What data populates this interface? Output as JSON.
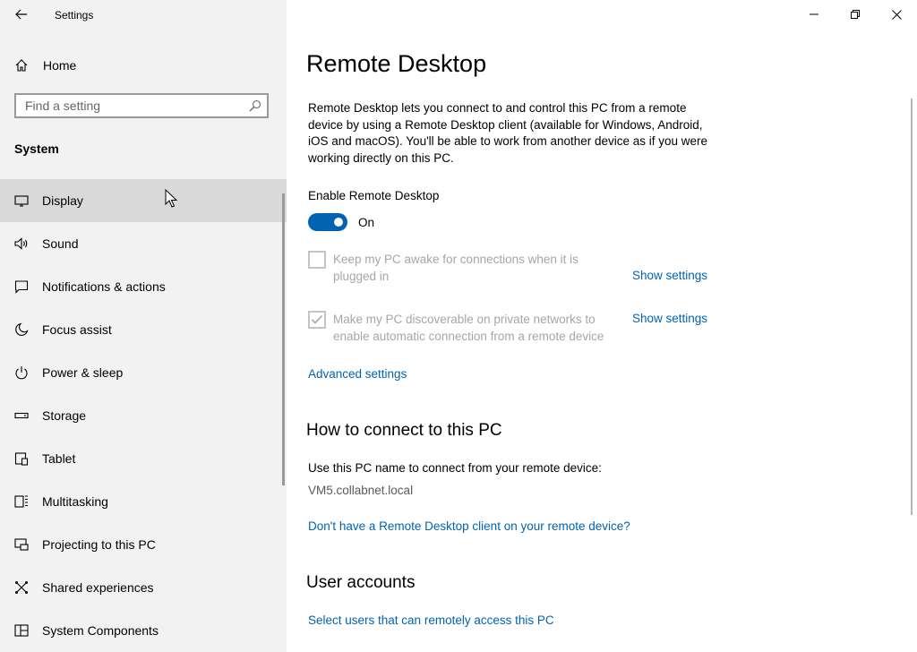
{
  "window": {
    "app_title": "Settings"
  },
  "sidebar": {
    "home_label": "Home",
    "search_placeholder": "Find a setting",
    "section_label": "System",
    "items": [
      {
        "label": "Display",
        "icon": "monitor-icon",
        "active": true
      },
      {
        "label": "Sound",
        "icon": "speaker-icon"
      },
      {
        "label": "Notifications & actions",
        "icon": "notification-icon"
      },
      {
        "label": "Focus assist",
        "icon": "moon-icon"
      },
      {
        "label": "Power & sleep",
        "icon": "power-icon"
      },
      {
        "label": "Storage",
        "icon": "storage-icon"
      },
      {
        "label": "Tablet",
        "icon": "tablet-icon"
      },
      {
        "label": "Multitasking",
        "icon": "multitasking-icon"
      },
      {
        "label": "Projecting to this PC",
        "icon": "projecting-icon"
      },
      {
        "label": "Shared experiences",
        "icon": "shared-icon"
      },
      {
        "label": "System Components",
        "icon": "components-icon"
      }
    ]
  },
  "main": {
    "title": "Remote Desktop",
    "description": "Remote Desktop lets you connect to and control this PC from a remote device by using a Remote Desktop client (available for Windows, Android, iOS and macOS). You'll be able to work from another device as if you were working directly on this PC.",
    "enable_label": "Enable Remote Desktop",
    "toggle_state": "On",
    "options": [
      {
        "label": "Keep my PC awake for connections when it is plugged in",
        "checked": false,
        "link": "Show settings"
      },
      {
        "label": "Make my PC discoverable on private networks to enable automatic connection from a remote device",
        "checked": true,
        "link": "Show settings"
      }
    ],
    "advanced_link": "Advanced settings",
    "connect_heading": "How to connect to this PC",
    "connect_text": "Use this PC name to connect from your remote device:",
    "pc_name": "VM5.collabnet.local",
    "client_link": "Don't have a Remote Desktop client on your remote device?",
    "accounts_heading": "User accounts",
    "accounts_link": "Select users that can remotely access this PC"
  },
  "colors": {
    "accent": "#0063b1",
    "sidebar_bg": "#f2f2f2",
    "active_item_bg": "#d9d9d9",
    "disabled_text": "#a6a6a6"
  }
}
